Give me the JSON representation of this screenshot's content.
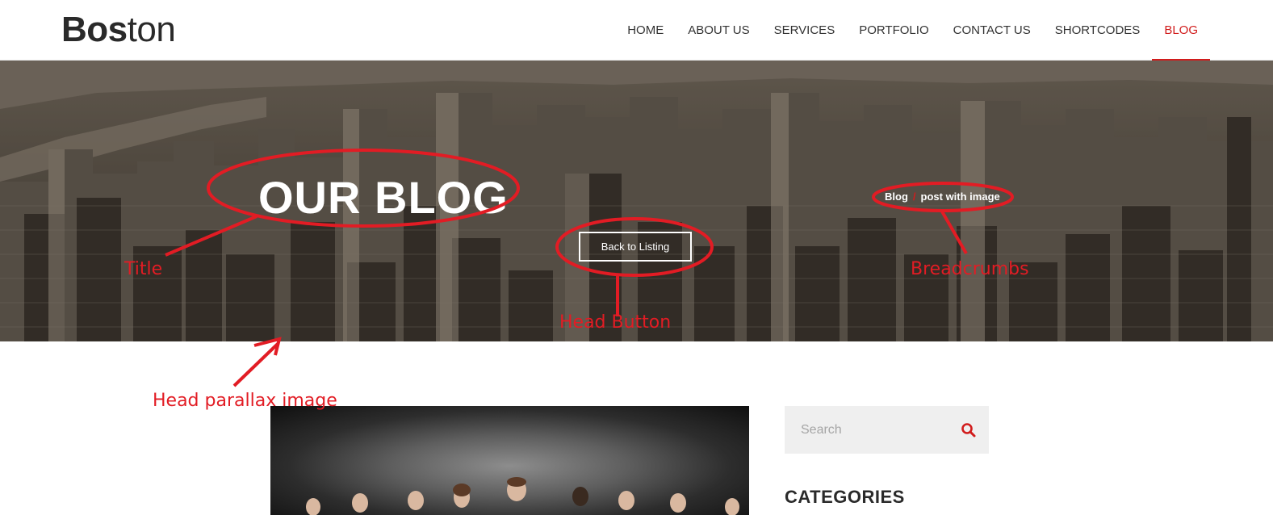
{
  "header": {
    "logo_bold": "Bos",
    "logo_light": "ton",
    "nav": [
      {
        "label": "HOME"
      },
      {
        "label": "ABOUT US"
      },
      {
        "label": "SERVICES"
      },
      {
        "label": "PORTFOLIO"
      },
      {
        "label": "CONTACT US"
      },
      {
        "label": "SHORTCODES"
      },
      {
        "label": "BLOG",
        "active": true
      }
    ]
  },
  "hero": {
    "title": "OUR BLOG",
    "button_label": "Back to Listing",
    "breadcrumb": {
      "first": "Blog",
      "separator": "/",
      "current": "post with image"
    }
  },
  "annotations": {
    "title": "Title",
    "button": "Head  Button",
    "breadcrumbs": "Breadcrumbs",
    "parallax": "Head parallax image"
  },
  "sidebar": {
    "search_placeholder": "Search",
    "categories_title": "CATEGORIES"
  },
  "colors": {
    "accent": "#d11c1c",
    "annotation": "#e21c24",
    "header_bg": "#ffffff",
    "search_bg": "#efefef"
  },
  "icons": {
    "search": "search-icon"
  }
}
